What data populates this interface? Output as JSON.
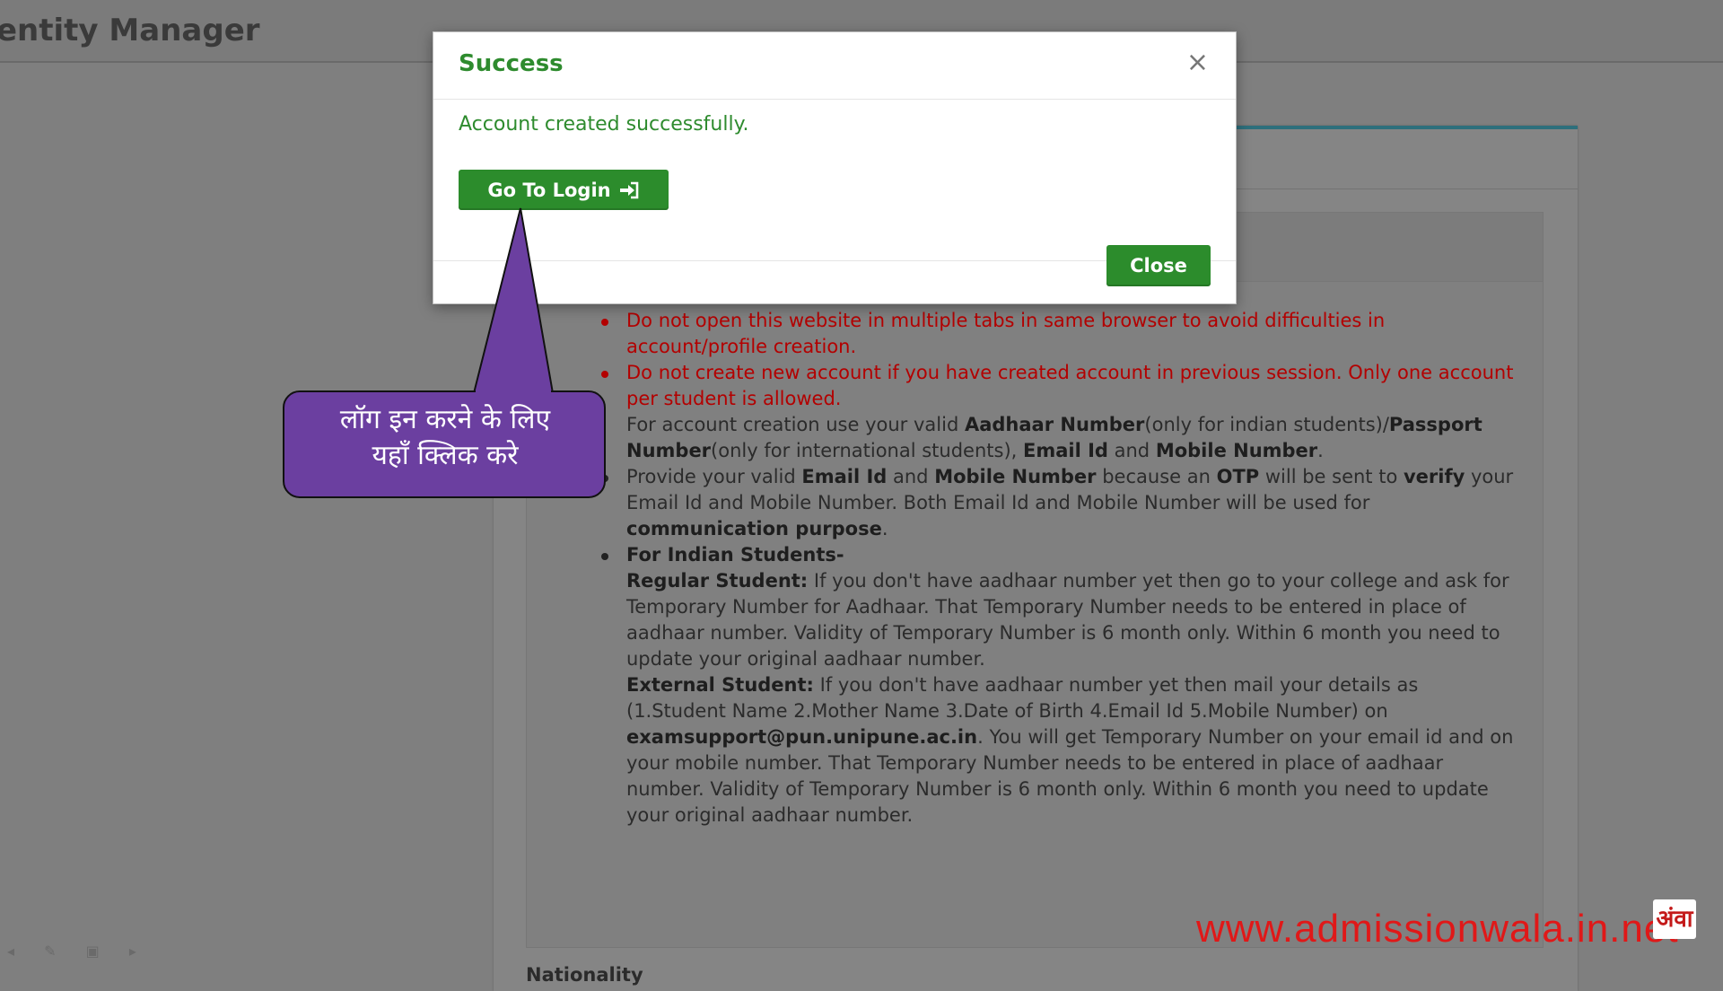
{
  "header": {
    "app_title": "entity Manager"
  },
  "modal": {
    "title": "Success",
    "close_symbol": "×",
    "message": "Account created successfully.",
    "login_button": "Go To Login",
    "login_icon": "sign-in-icon",
    "close_button": "Close"
  },
  "callout": {
    "line1": "लॉग इन करने के लिए",
    "line2": "यहाँ क्लिक करे",
    "color": "#6b3fa0"
  },
  "instructions": [
    {
      "text": "Do not open this website in multiple tabs in same browser to avoid difficulties in account/profile creation."
    },
    {
      "text": "Do not create new account if you have created account in previous session. Only one account per student is allowed."
    },
    {
      "p1": "For account creation use your valid ",
      "b1": "Aadhaar Number",
      "p2": "(only for indian students)/",
      "b2": "Passport Number",
      "p3": "(only for international students), ",
      "b3": "Email Id",
      "p4": " and ",
      "b4": "Mobile Number",
      "p5": "."
    },
    {
      "p1": "Provide your valid ",
      "b1": "Email Id",
      "p2": " and ",
      "b2": "Mobile Number",
      "p3": " because an ",
      "b3": "OTP",
      "p4": " will be sent to ",
      "b4": "verify",
      "p5": " your Email Id and Mobile Number. Both Email Id and Mobile Number will be used for ",
      "b5": "communication purpose",
      "p6": "."
    },
    {
      "heading": "For Indian Students-",
      "regular_label": "Regular Student:",
      "regular_text": " If you don't have aadhaar number yet then go to your college and ask for Temporary Number for Aadhaar. That Temporary Number needs to be entered in place of aadhaar number. Validity of Temporary Number is 6 month only. Within 6 month you need to update your original aadhaar number.",
      "external_label": "External Student:",
      "external_text1": " If you don't have aadhaar number yet then mail your details as (1.Student Name 2.Mother Name 3.Date of Birth 4.Email Id 5.Mobile Number) on ",
      "external_email": "examsupport@pun.unipune.ac.in",
      "external_text2": ". You will get Temporary Number on your email id and on your mobile number. That Temporary Number needs to be entered in place of aadhaar number. Validity of Temporary Number is 6 month only. Within 6 month you need to update your original aadhaar number."
    }
  ],
  "footer_label": "Nationality",
  "watermark": {
    "text": "www.admissionwala.in.net",
    "logo_text": "अंवा"
  },
  "colors": {
    "success_green": "#2c8c2c",
    "warning_red": "#b30000",
    "callout_purple": "#6b3fa0",
    "accent_teal": "#2d6f7c"
  }
}
